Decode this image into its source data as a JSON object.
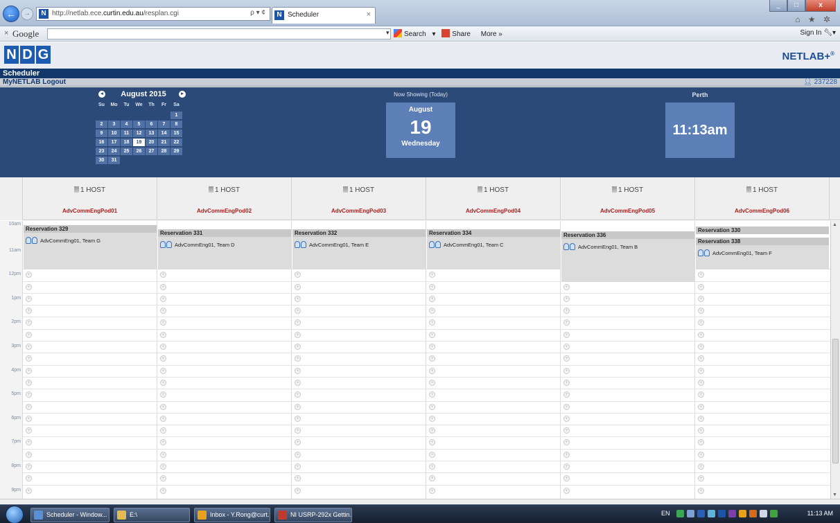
{
  "browser": {
    "url_prefix": "http://netlab.ece.",
    "url_host": "curtin.edu.au",
    "url_suffix": "/resplan.cgi",
    "address_tools": "ρ ▾ ¢",
    "tab_title": "Scheduler",
    "tab_close": "×",
    "back_glyph": "←",
    "forward_glyph": "→",
    "favicon_letter": "N",
    "window_controls": {
      "min": "_",
      "max": "□",
      "close": "x"
    },
    "chrome_icons": "⌂ ★ ✲"
  },
  "toolbar": {
    "close": "×",
    "google_label": "Google",
    "dropdown_glyph": "▾",
    "search_label": "Search",
    "share_label": "Share",
    "more_label": "More »",
    "signin_label": "Sign In"
  },
  "app": {
    "logo_letters": [
      "N",
      "D",
      "G"
    ],
    "netlab_label": "NETLAB+",
    "netlab_mark": "®",
    "section_title": "Scheduler",
    "nav_links": "MyNETLAB  Logout",
    "user_id": "237228"
  },
  "calendar": {
    "prev_glyph": "◂",
    "next_glyph": "▸",
    "title": "August 2015",
    "dow": [
      "Su",
      "Mo",
      "Tu",
      "We",
      "Th",
      "Fr",
      "Sa"
    ],
    "leading_blank": 6,
    "days": [
      "1",
      "2",
      "3",
      "4",
      "5",
      "6",
      "7",
      "8",
      "9",
      "10",
      "11",
      "12",
      "13",
      "14",
      "15",
      "16",
      "17",
      "18",
      "19",
      "20",
      "21",
      "22",
      "23",
      "24",
      "25",
      "26",
      "27",
      "28",
      "29",
      "30",
      "31"
    ],
    "today": "19"
  },
  "now_showing": {
    "label": "Now Showing (Today)",
    "month": "August",
    "day": "19",
    "weekday": "Wednesday"
  },
  "clock": {
    "city": "Perth",
    "time": "11:13am"
  },
  "pods": [
    {
      "host": "1 HOST",
      "name": "AdvCommEngPod01"
    },
    {
      "host": "1 HOST",
      "name": "AdvCommEngPod02"
    },
    {
      "host": "1 HOST",
      "name": "AdvCommEngPod03"
    },
    {
      "host": "1 HOST",
      "name": "AdvCommEngPod04"
    },
    {
      "host": "1 HOST",
      "name": "AdvCommEngPod05"
    },
    {
      "host": "1 HOST",
      "name": "AdvCommEngPod06"
    }
  ],
  "time_labels": [
    "10am",
    "11am",
    "12pm",
    "1pm",
    "2pm",
    "3pm",
    "4pm",
    "5pm",
    "6pm",
    "7pm",
    "8pm",
    "9pm"
  ],
  "reservations": [
    {
      "pod": 0,
      "title": "Reservation 329",
      "team": "AdvCommEng01, Team G"
    },
    {
      "pod": 1,
      "title": "Reservation 331",
      "team": "AdvCommEng01, Team D"
    },
    {
      "pod": 2,
      "title": "Reservation 332",
      "team": "AdvCommEng01, Team E"
    },
    {
      "pod": 3,
      "title": "Reservation 334",
      "team": "AdvCommEng01, Team C"
    },
    {
      "pod": 4,
      "title": "Reservation 336",
      "team": "AdvCommEng01, Team B"
    },
    {
      "pod": 5,
      "title": "Reservation 330",
      "team": ""
    },
    {
      "pod": 5,
      "title": "Reservation 338",
      "team": "AdvCommEng01, Team F"
    }
  ],
  "slot_glyph": "+",
  "scroll": {
    "up": "▲",
    "down": "▼"
  },
  "taskbar": {
    "tasks": [
      "Scheduler - Window...",
      "E:\\",
      "Inbox - Y.Rong@curt...",
      "NI USRP-292x Gettin..."
    ],
    "lang": "EN",
    "time": "11:13 AM",
    "colors": [
      "#9fb6d6",
      "#444",
      "#e6a21c",
      "#c03a2b"
    ]
  }
}
